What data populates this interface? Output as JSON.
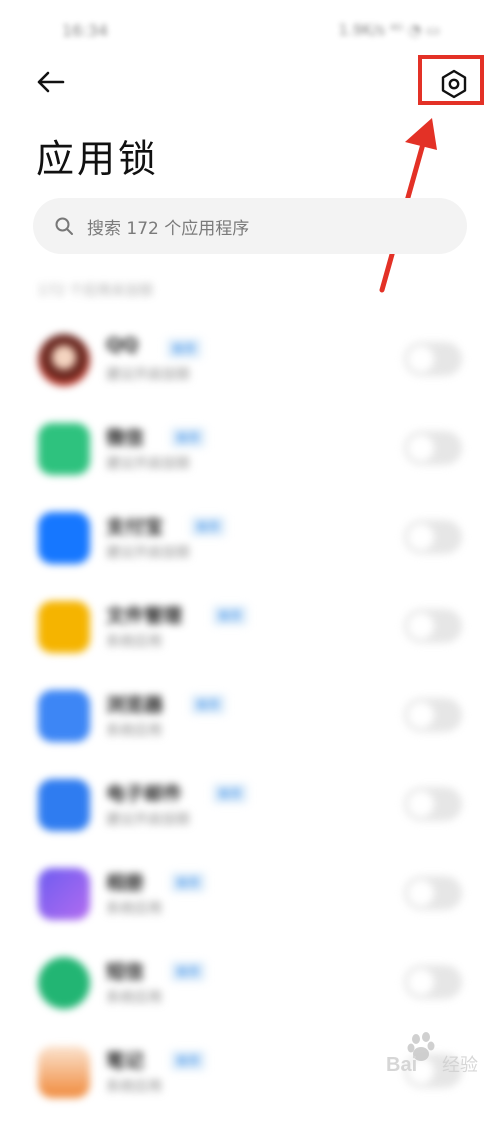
{
  "status_bar": {
    "time": "16:34",
    "right": "1.9K/s ⁴ᴳ ◔ ▭"
  },
  "header": {
    "back_icon": "arrow-left-icon",
    "settings_icon": "hexagon-gear-icon"
  },
  "page": {
    "title": "应用锁"
  },
  "search": {
    "placeholder": "搜索 172 个应用程序",
    "icon": "search-icon"
  },
  "list": {
    "section_header": "172 个应用未加锁",
    "apps": [
      {
        "name": "QQ",
        "tag": "推荐",
        "sub": "建议开启加锁",
        "color": "#c0392b"
      },
      {
        "name": "微信",
        "tag": "推荐",
        "sub": "建议开启加锁",
        "color": "#2ec27e"
      },
      {
        "name": "支付宝",
        "tag": "推荐",
        "sub": "建议开启加锁",
        "color": "#1677ff"
      },
      {
        "name": "文件管理",
        "tag": "推荐",
        "sub": "系统应用",
        "color": "#f5b400"
      },
      {
        "name": "浏览器",
        "tag": "推荐",
        "sub": "系统应用",
        "color": "#3d86f5"
      },
      {
        "name": "电子邮件",
        "tag": "推荐",
        "sub": "建议开启加锁",
        "color": "#2f7cf0"
      },
      {
        "name": "相册",
        "tag": "推荐",
        "sub": "系统应用",
        "color": "#7b5cf0"
      },
      {
        "name": "短信",
        "tag": "推荐",
        "sub": "系统应用",
        "color": "#22b573"
      },
      {
        "name": "笔记",
        "tag": "推荐",
        "sub": "系统应用",
        "color": "#f08a3c"
      }
    ]
  },
  "annotation": {
    "highlight_color": "#e33126"
  },
  "watermark": {
    "text": "Bai 经验"
  }
}
